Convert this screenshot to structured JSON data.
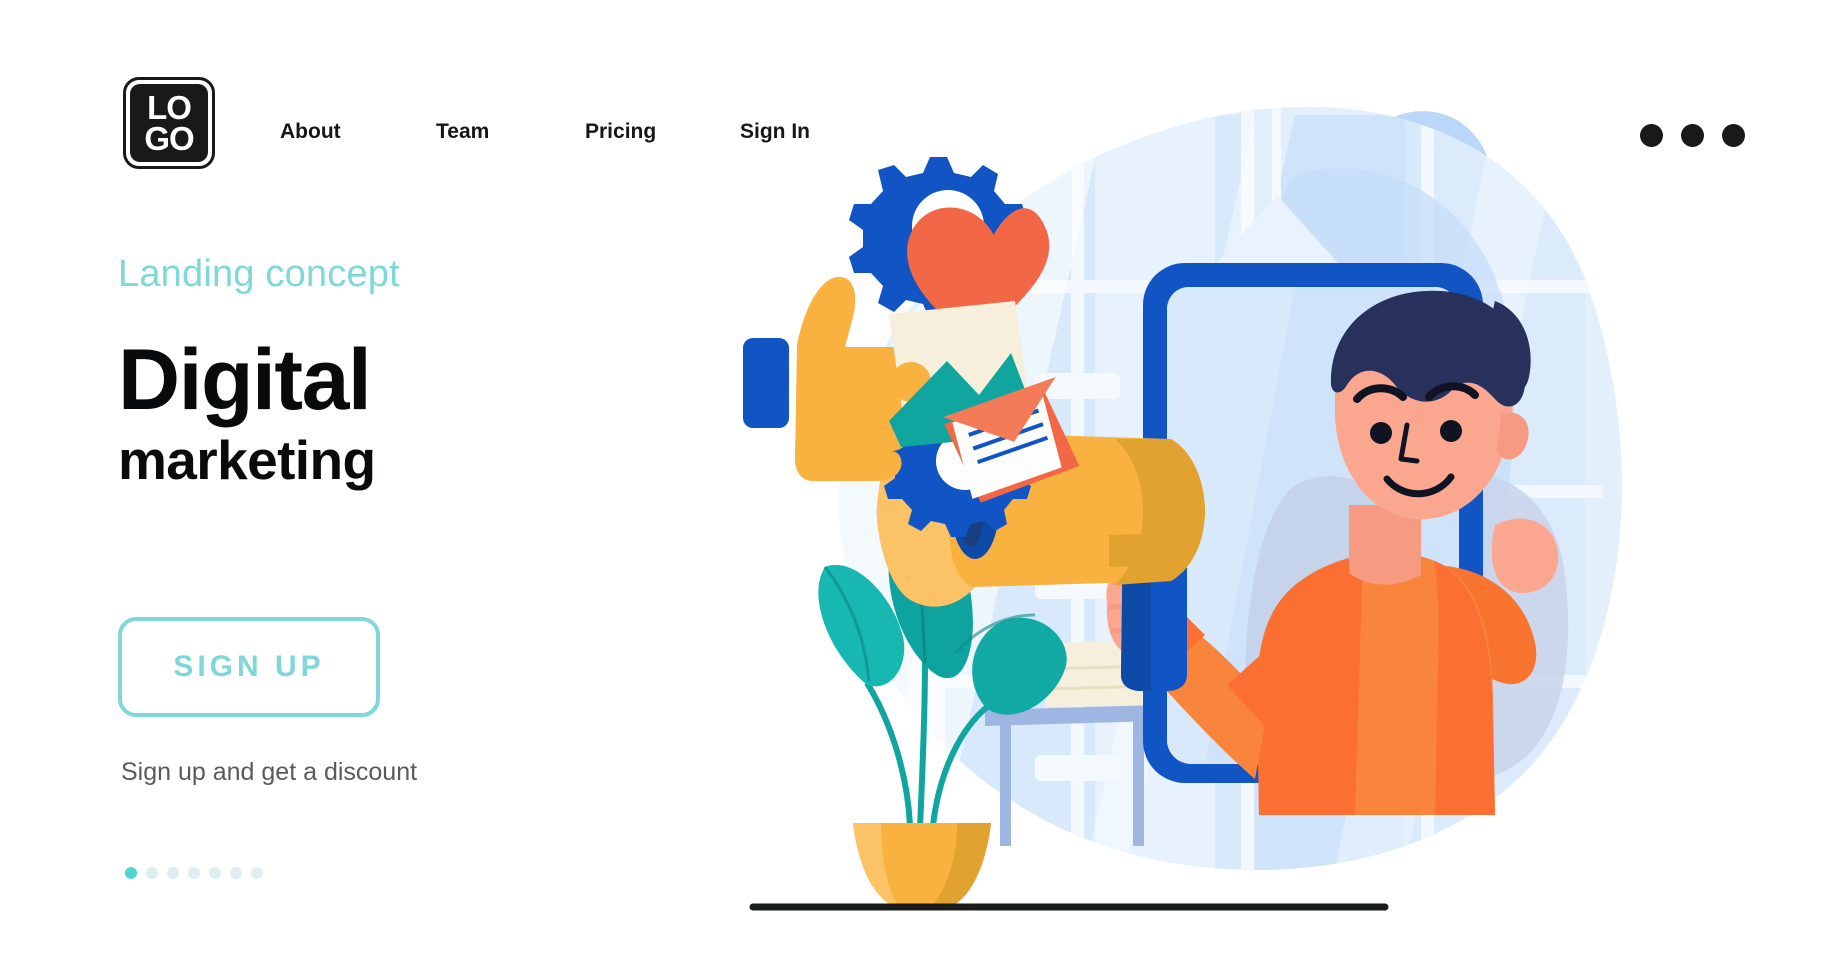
{
  "header": {
    "logo": {
      "line1": "LO",
      "line2": "GO",
      "name": "logo"
    },
    "nav": [
      {
        "label": "About"
      },
      {
        "label": "Team"
      },
      {
        "label": "Pricing"
      },
      {
        "label": "Sign In"
      }
    ],
    "menu_icon": "more-horizontal-icon"
  },
  "hero": {
    "eyebrow": "Landing concept",
    "title_line1": "Digital",
    "title_line2": "marketing",
    "cta_label": "SIGN UP",
    "subnote": "Sign up and get a discount",
    "carousel": {
      "total": 7,
      "active_index": 0
    }
  },
  "illustration": {
    "name": "digital-marketing-illustration",
    "elements": [
      "gear-icon",
      "heart-icon",
      "thumbs-up-icon",
      "image-photo-icon",
      "gear-icon-small",
      "envelope-mail-icon",
      "megaphone-icon",
      "smartphone-device",
      "man-character",
      "potted-plant",
      "side-table",
      "window-background",
      "hanging-lamp",
      "ground-line"
    ]
  },
  "colors": {
    "accent_teal": "#7fd8d8",
    "accent_teal_active": "#4fd3d3",
    "text_dark": "#090a0b",
    "text_muted": "#585b5e",
    "brand_blue": "#1155c4",
    "brand_blue_dark": "#0e4aa8",
    "orange": "#f97738",
    "orange_deep": "#fa6a32",
    "red_orange": "#f26745",
    "yellow": "#f9b23f",
    "yellow_dark": "#e2a22f",
    "green_teal": "#11a5a0",
    "skin": "#fba790",
    "hair_navy": "#27315c",
    "bg_blue_light": "#d4e6fa",
    "bg_blue_mid": "#b9d7f8",
    "white": "#ffffff"
  }
}
